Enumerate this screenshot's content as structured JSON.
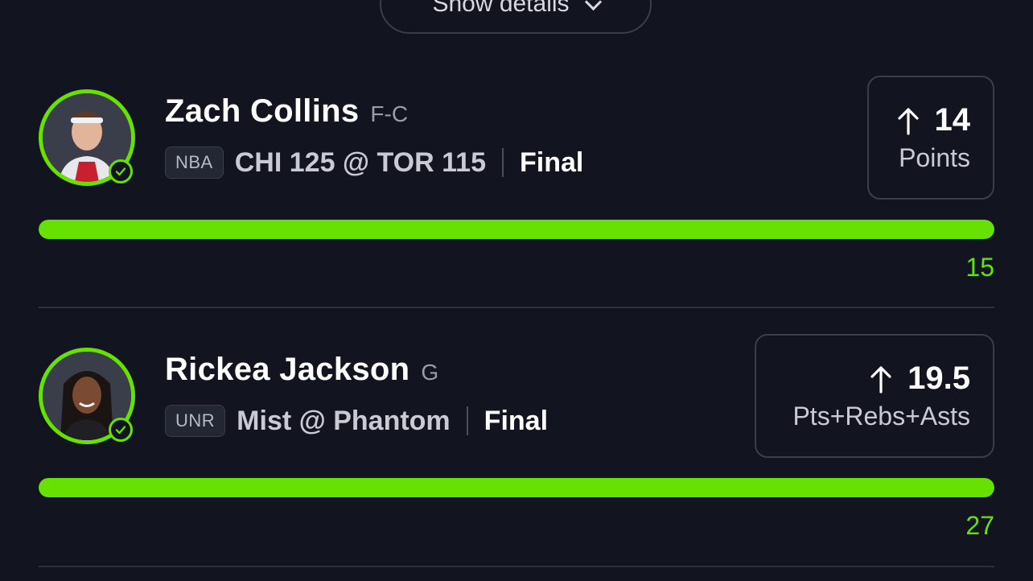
{
  "header": {
    "details_label": "Show details"
  },
  "colors": {
    "background": "#121420",
    "accent_green": "#66e100",
    "border": "#3a3d4c"
  },
  "picks": [
    {
      "player_name": "Zach Collins",
      "position": "F-C",
      "league": "NBA",
      "matchup": "CHI 125 @ TOR 115",
      "status": "Final",
      "direction_icon": "arrow-up-icon",
      "line": "14",
      "stat": "Points",
      "actual": "15",
      "progress": 1.0,
      "result_icon": "check-icon"
    },
    {
      "player_name": "Rickea Jackson",
      "position": "G",
      "league": "UNR",
      "matchup": "Mist @ Phantom",
      "status": "Final",
      "direction_icon": "arrow-up-icon",
      "line": "19.5",
      "stat": "Pts+Rebs+Asts",
      "actual": "27",
      "progress": 1.0,
      "result_icon": "check-icon"
    }
  ]
}
